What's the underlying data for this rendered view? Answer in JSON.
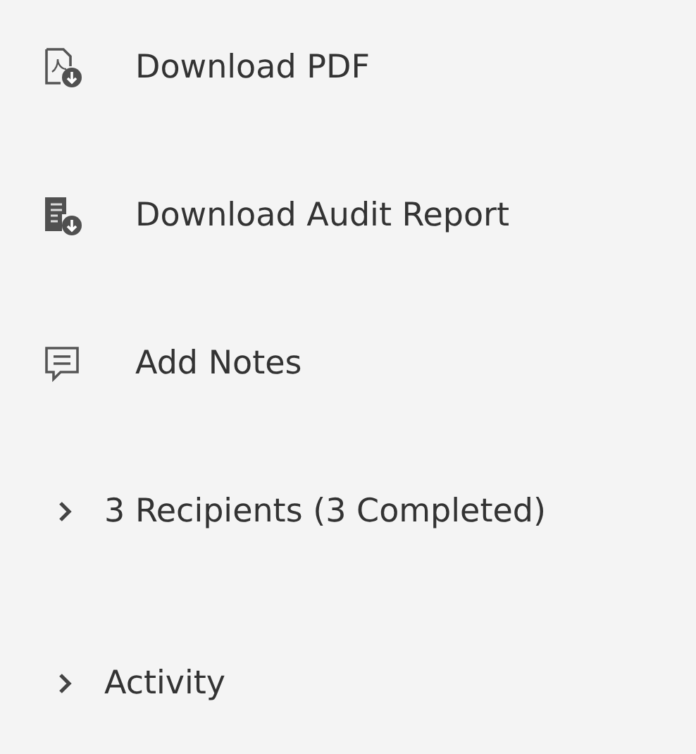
{
  "actions": [
    {
      "kind": "pdf",
      "label": "Download PDF"
    },
    {
      "kind": "audit",
      "label": "Download Audit Report"
    },
    {
      "kind": "notes",
      "label": "Add Notes"
    }
  ],
  "sections": [
    {
      "label": "3 Recipients (3 Completed)",
      "expanded": false
    },
    {
      "label": "Activity",
      "expanded": false
    }
  ]
}
